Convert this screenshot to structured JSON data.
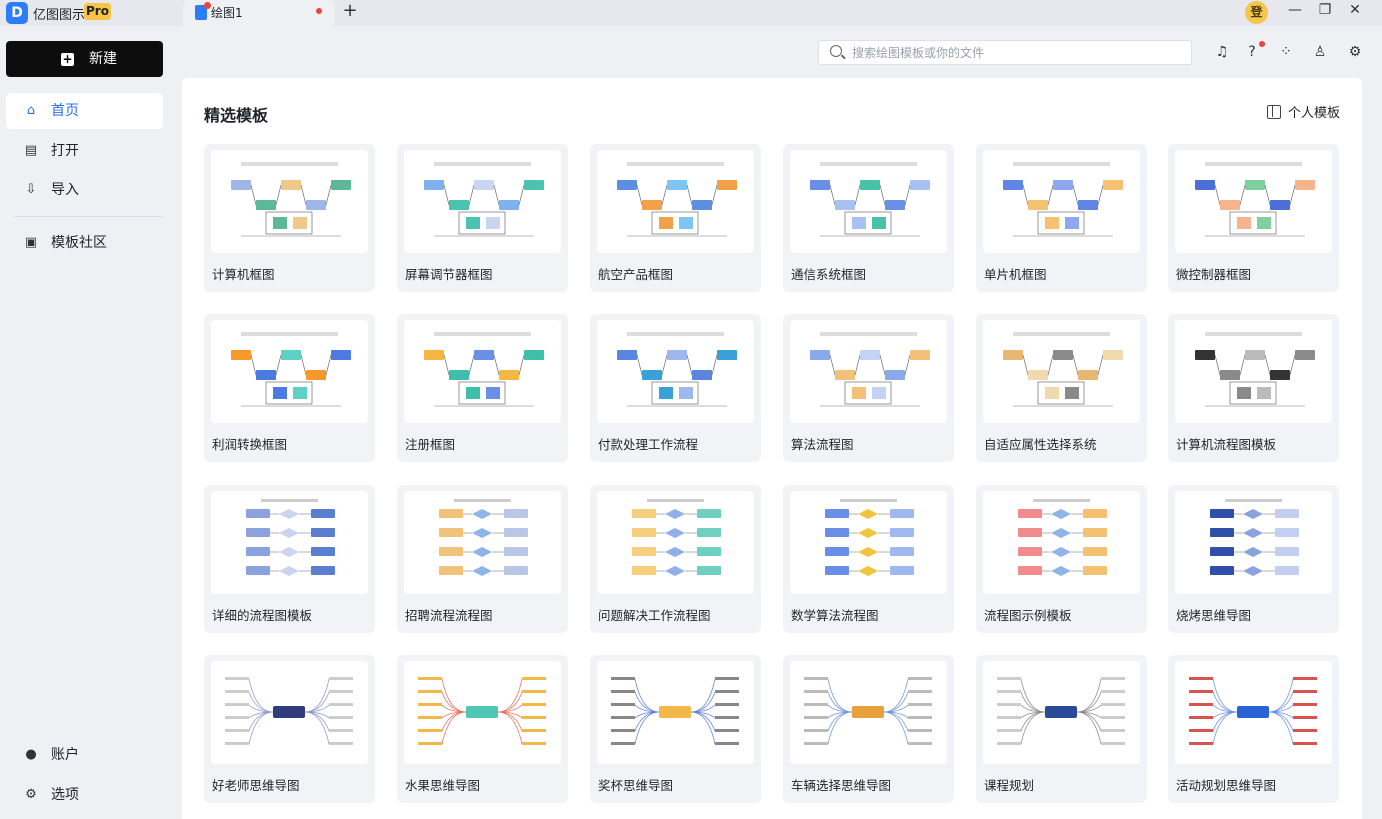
{
  "app": {
    "name": "亿图图示",
    "badge": "Pro",
    "logo_letter": "D"
  },
  "tabs": [
    {
      "label": "绘图1"
    }
  ],
  "titlebar": {
    "avatar_text": "登"
  },
  "sidebar": {
    "new_label": "新建",
    "items": [
      {
        "label": "首页",
        "icon": "home-icon",
        "active": true
      },
      {
        "label": "打开",
        "icon": "file-icon"
      },
      {
        "label": "导入",
        "icon": "import-icon"
      },
      {
        "label": "模板社区",
        "icon": "community-icon"
      }
    ],
    "bottom_items": [
      {
        "label": "账户",
        "icon": "user-icon"
      },
      {
        "label": "选项",
        "icon": "gear-icon"
      }
    ]
  },
  "search": {
    "placeholder": "搜索绘图模板或你的文件"
  },
  "main": {
    "section_title": "精选模板",
    "personal_templates": "个人模板",
    "templates": [
      "计算机框图",
      "屏幕调节器框图",
      "航空产品框图",
      "通信系统框图",
      "单片机框图",
      "微控制器框图",
      "利润转换框图",
      "注册框图",
      "付款处理工作流程",
      "算法流程图",
      "自适应属性选择系统",
      "计算机流程图模板",
      "详细的流程图模板",
      "招聘流程流程图",
      "问题解决工作流程图",
      "数学算法流程图",
      "流程图示例模板",
      "烧烤思维导图",
      "好老师思维导图",
      "水果思维导图",
      "奖杯思维导图",
      "车辆选择思维导图",
      "课程规划",
      "活动规划思维导图"
    ]
  },
  "colors": {
    "accent": "#2c6fe0",
    "brand": "#2c7ef8",
    "pro_badge": "#f7c446",
    "new_button": "#0d0d0d"
  }
}
